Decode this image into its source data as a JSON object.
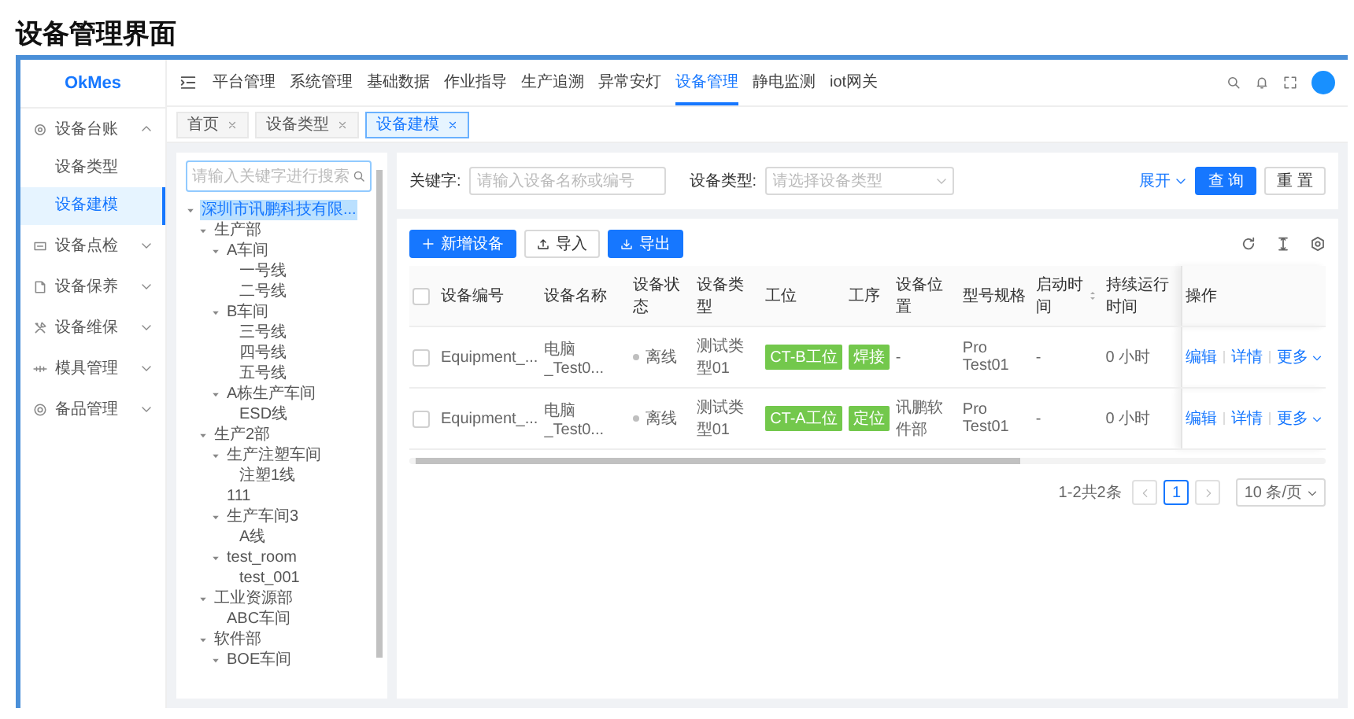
{
  "page_title": "设备管理界面",
  "app": {
    "logo": "OkMes"
  },
  "top_nav": [
    {
      "label": "平台管理",
      "selected": false
    },
    {
      "label": "系统管理",
      "selected": false
    },
    {
      "label": "基础数据",
      "selected": false
    },
    {
      "label": "作业指导",
      "selected": false
    },
    {
      "label": "生产追溯",
      "selected": false
    },
    {
      "label": "异常安灯",
      "selected": false
    },
    {
      "label": "设备管理",
      "selected": true
    },
    {
      "label": "静电监测",
      "selected": false
    },
    {
      "label": "iot网关",
      "selected": false
    }
  ],
  "sidebar": {
    "items": [
      {
        "label": "设备台账",
        "expanded": true,
        "children": [
          {
            "label": "设备类型",
            "selected": false
          },
          {
            "label": "设备建模",
            "selected": true
          }
        ]
      },
      {
        "label": "设备点检",
        "expanded": false
      },
      {
        "label": "设备保养",
        "expanded": false
      },
      {
        "label": "设备维保",
        "expanded": false
      },
      {
        "label": "模具管理",
        "expanded": false
      },
      {
        "label": "备品管理",
        "expanded": false
      }
    ]
  },
  "tabs": [
    {
      "label": "首页",
      "selected": false
    },
    {
      "label": "设备类型",
      "selected": false
    },
    {
      "label": "设备建模",
      "selected": true
    }
  ],
  "tree": {
    "search_placeholder": "请输入关键字进行搜索",
    "nodes": [
      {
        "label": "深圳市讯鹏科技有限...",
        "selected": true,
        "expanded": true,
        "children": [
          {
            "label": "生产部",
            "selected": false,
            "expanded": true,
            "children": [
              {
                "label": "A车间",
                "selected": false,
                "expanded": true,
                "children": [
                  {
                    "label": "一号线",
                    "selected": false
                  },
                  {
                    "label": "二号线",
                    "selected": false
                  }
                ]
              },
              {
                "label": "B车间",
                "selected": false,
                "expanded": true,
                "children": [
                  {
                    "label": "三号线",
                    "selected": false
                  },
                  {
                    "label": "四号线",
                    "selected": false
                  },
                  {
                    "label": "五号线",
                    "selected": false
                  }
                ]
              },
              {
                "label": "A栋生产车间",
                "selected": false,
                "expanded": true,
                "children": [
                  {
                    "label": "ESD线",
                    "selected": false
                  }
                ]
              }
            ]
          },
          {
            "label": "生产2部",
            "selected": false,
            "expanded": true,
            "children": [
              {
                "label": "生产注塑车间",
                "selected": false,
                "expanded": true,
                "children": [
                  {
                    "label": "注塑1线",
                    "selected": false
                  }
                ]
              },
              {
                "label": "111",
                "selected": false
              },
              {
                "label": "生产车间3",
                "selected": false,
                "expanded": true,
                "children": [
                  {
                    "label": "A线",
                    "selected": false
                  }
                ]
              },
              {
                "label": "test_room",
                "selected": false,
                "expanded": true,
                "children": [
                  {
                    "label": "test_001",
                    "selected": false
                  }
                ]
              }
            ]
          },
          {
            "label": "工业资源部",
            "selected": false,
            "expanded": true,
            "children": [
              {
                "label": "ABC车间",
                "selected": false
              }
            ]
          },
          {
            "label": "软件部",
            "selected": false,
            "expanded": true,
            "children": [
              {
                "label": "BOE车间",
                "selected": false,
                "expanded": true
              }
            ]
          }
        ]
      }
    ]
  },
  "filters": {
    "keyword": {
      "label": "关键字:",
      "placeholder": "请输入设备名称或编号"
    },
    "device_type": {
      "label": "设备类型:",
      "placeholder": "请选择设备类型"
    },
    "expand_link": "展开",
    "buttons": [
      {
        "label": "查 询",
        "kind": "primary"
      },
      {
        "label": "重 置",
        "kind": "default"
      }
    ]
  },
  "toolbar": {
    "buttons": [
      {
        "label": "新增设备",
        "kind": "primary"
      },
      {
        "label": "导入",
        "kind": "default"
      },
      {
        "label": "导出",
        "kind": "primary"
      }
    ]
  },
  "table": {
    "select_all": {
      "checked": false
    },
    "columns": [
      {
        "label": "设备编号",
        "sortable": false
      },
      {
        "label": "设备名称",
        "sortable": false
      },
      {
        "label": "设备状态",
        "sortable": false
      },
      {
        "label": "设备类型",
        "sortable": false
      },
      {
        "label": "工位",
        "sortable": false
      },
      {
        "label": "工序",
        "sortable": false
      },
      {
        "label": "设备位置",
        "sortable": false
      },
      {
        "label": "型号规格",
        "sortable": false
      },
      {
        "label": "启动时间",
        "sortable": true
      },
      {
        "label": "持续运行时间",
        "sortable": false
      },
      {
        "label": "操作",
        "sortable": false
      }
    ],
    "rows": [
      {
        "checked": false,
        "cells": [
          {
            "kind": "text",
            "text": "Equipment_..."
          },
          {
            "kind": "text",
            "text": "电脑_Test0..."
          },
          {
            "kind": "status",
            "text": "离线"
          },
          {
            "kind": "text",
            "text": "测试类型01"
          },
          {
            "kind": "tag",
            "text": "CT-B工位"
          },
          {
            "kind": "tag",
            "text": "焊接"
          },
          {
            "kind": "text",
            "text": "-"
          },
          {
            "kind": "text",
            "text": "Pro Test01"
          },
          {
            "kind": "text",
            "text": "-"
          },
          {
            "kind": "text",
            "text": "0 小时"
          },
          {
            "kind": "actions",
            "actions": [
              "编辑",
              "详情",
              "更多"
            ]
          }
        ]
      },
      {
        "checked": false,
        "cells": [
          {
            "kind": "text",
            "text": "Equipment_..."
          },
          {
            "kind": "text",
            "text": "电脑_Test0..."
          },
          {
            "kind": "status",
            "text": "离线"
          },
          {
            "kind": "text",
            "text": "测试类型01"
          },
          {
            "kind": "tag",
            "text": "CT-A工位"
          },
          {
            "kind": "tag",
            "text": "定位"
          },
          {
            "kind": "text",
            "text": "讯鹏软件部"
          },
          {
            "kind": "text",
            "text": "Pro Test01"
          },
          {
            "kind": "text",
            "text": "-"
          },
          {
            "kind": "text",
            "text": "0 小时"
          },
          {
            "kind": "actions",
            "actions": [
              "编辑",
              "详情",
              "更多"
            ]
          }
        ]
      }
    ]
  },
  "pagination": {
    "summary": "1-2共2条",
    "pages": [
      {
        "label": "1",
        "selected": true
      }
    ],
    "page_size": "10 条/页"
  }
}
